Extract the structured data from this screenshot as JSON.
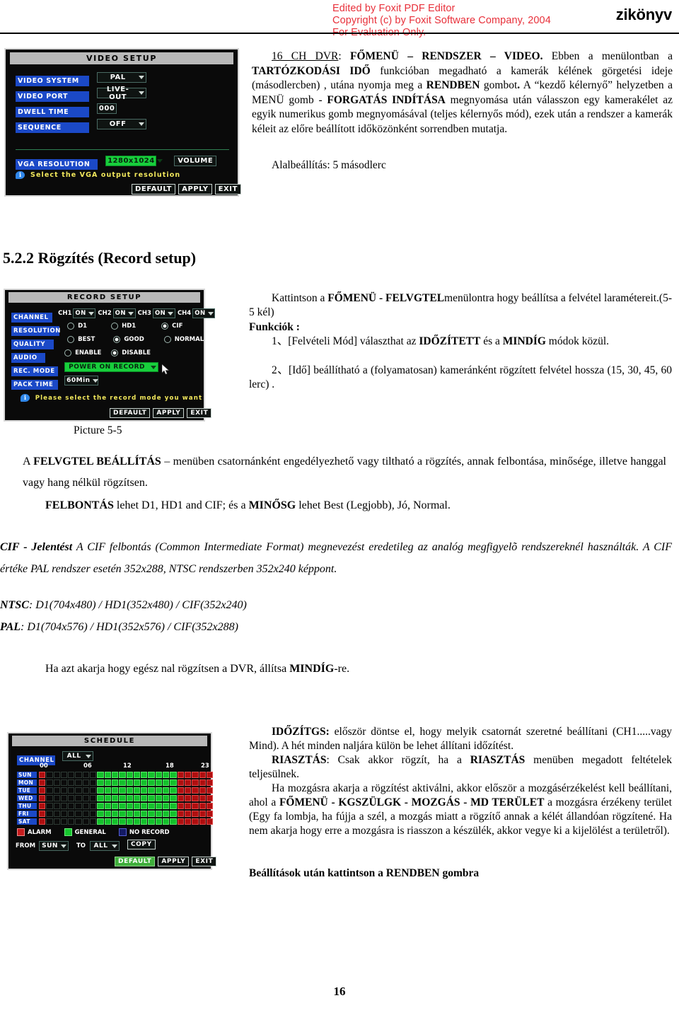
{
  "header": {
    "watermark_line1": "Edited by Foxit PDF Editor",
    "watermark_line2": "Copyright (c) by Foxit Software Company, 2004",
    "watermark_line3": "For Evaluation Only.",
    "doc_title_fragment": "zikönyv"
  },
  "video_setup": {
    "title": "VIDEO SETUP",
    "rows": [
      {
        "label": "VIDEO SYSTEM",
        "value": "PAL",
        "control": "dropdown"
      },
      {
        "label": "VIDEO PORT",
        "value": "LIVE-OUT",
        "control": "dropdown"
      },
      {
        "label": "DWELL TIME",
        "value": "000",
        "control": "textbox"
      },
      {
        "label": "SEQUENCE",
        "value": "OFF",
        "control": "dropdown"
      }
    ],
    "vga_label": "VGA RESOLUTION",
    "vga_value": "1280x1024",
    "volume_label": "VOLUME",
    "hint": "Select the VGA output resolution",
    "buttons": [
      "DEFAULT",
      "APPLY",
      "EXIT"
    ]
  },
  "video_text": {
    "lines": [
      {
        "t": "16 CH DVR",
        "s": "u"
      },
      {
        "t": ": ",
        "s": "n"
      },
      {
        "t": "FŐMENÜ – RENDSZER – VIDEO.",
        "s": "b"
      },
      {
        "t": " Ebben a menülontban a ",
        "s": "n"
      },
      {
        "t": "TARTÓZKODÁSI IDŐ",
        "s": "b"
      },
      {
        "t": " funkcióban megadható  a kamerák kélének görgetési ideje (másodlercben) , utána nyomja meg a ",
        "s": "n"
      },
      {
        "t": "RENDBEN",
        "s": "b"
      },
      {
        "t": " gombot",
        "s": "n"
      },
      {
        "t": ".",
        "s": "b"
      },
      {
        "t": "  A “kezdő kélernyő” helyzetben a MENÜ gomb - ",
        "s": "n"
      },
      {
        "t": "FORGATÁS INDÍTÁSA",
        "s": "b"
      },
      {
        "t": " megnyomása után válasszon egy kamerakélet az egyik numerikus gomb megnyomásával (teljes kélernyős mód), ezek után a rendszer a kamerák kéleit az előre beállított időközönként sorrendben mutatja.",
        "s": "n"
      }
    ],
    "default_line": "Alalbeállítás:  5 másodlerc"
  },
  "section_heading": "5.2.2 Rögzítés (Record setup)",
  "record_setup": {
    "title": "RECORD SETUP",
    "channel_label": "CHANNEL",
    "channels": [
      {
        "name": "CH1",
        "value": "ON"
      },
      {
        "name": "CH2",
        "value": "ON"
      },
      {
        "name": "CH3",
        "value": "ON"
      },
      {
        "name": "CH4",
        "value": "ON"
      }
    ],
    "resolution_label": "RESOLUTION",
    "resolution_options": [
      {
        "label": "D1",
        "selected": false
      },
      {
        "label": "HD1",
        "selected": false
      },
      {
        "label": "CIF",
        "selected": true
      }
    ],
    "quality_label": "QUALITY",
    "quality_options": [
      {
        "label": "BEST",
        "selected": false
      },
      {
        "label": "GOOD",
        "selected": true
      },
      {
        "label": "NORMAL",
        "selected": false
      }
    ],
    "audio_label": "AUDIO",
    "audio_options": [
      {
        "label": "ENABLE",
        "selected": false
      },
      {
        "label": "DISABLE",
        "selected": true
      }
    ],
    "rec_mode_label": "REC. MODE",
    "rec_mode_value": "POWER ON RECORD",
    "pack_time_label": "PACK TIME",
    "pack_time_value": "60Min",
    "hint": "Please select the record mode you want",
    "buttons": [
      "DEFAULT",
      "APPLY",
      "EXIT"
    ]
  },
  "record_caption": "Picture 5-5",
  "record_text": {
    "lines": [
      {
        "t": "Kattintson a ",
        "s": "n"
      },
      {
        "t": "FŐMENÜ - FELVGTEL",
        "s": "b"
      },
      {
        "t": "menülontra hogy beállítsa a felvétel laramétereit.(5-5 kél)",
        "s": "n"
      }
    ],
    "functions_label": "Funkciók :",
    "items": [
      {
        "prefix": "1、",
        "parts": [
          {
            "t": "[Felvételi Mód] választhat az ",
            "s": "n"
          },
          {
            "t": "IDŐZÍTETT",
            "s": "b"
          },
          {
            "t": "  és a ",
            "s": "n"
          },
          {
            "t": "MINDÍG",
            "s": "b"
          },
          {
            "t": " módok közül.",
            "s": "n"
          }
        ]
      },
      {
        "prefix": "2、",
        "parts": [
          {
            "t": "[Idő] beállítható a (folyamatosan) kameránként rögzített felvétel hossza (15, 30, 45, 60 lerc) .",
            "s": "n"
          }
        ]
      }
    ]
  },
  "para_felvgtel": [
    {
      "t": "A ",
      "s": "n"
    },
    {
      "t": "FELVGTEL BEÁLLÍTÁS ",
      "s": "b"
    },
    {
      "t": "– menüben csatornánként engedélyezhető vagy tiltható a rögzítés, annak felbontása, minősége, illetve hanggal vagy hang nélkül rögzítsen.",
      "s": "n"
    }
  ],
  "para_felbontas": [
    {
      "t": "FELBONTÁS",
      "s": "b"
    },
    {
      "t": "  lehet  D1, HD1 and CIF; és a  ",
      "s": "n"
    },
    {
      "t": "MINŐSG",
      "s": "b"
    },
    {
      "t": "   lehet Best (Legjobb), Jó, Normal.",
      "s": "n"
    }
  ],
  "para_cif": [
    {
      "t": "CIF - Jelentést",
      "s": "bi"
    },
    {
      "t": " A CIF felbontás (Common Intermediate Format) megnevezést eredetileg az analóg megfigyelõ rendszereknél használták. A CIF értéke PAL rendszer esetén 352x288, NTSC rendszerben 352x240 képpont.",
      "s": "i"
    }
  ],
  "line_ntsc": [
    {
      "t": "NTSC",
      "s": "bi"
    },
    {
      "t": ": D1(704x480) / HD1(352x480) / CIF(352x240)",
      "s": "i"
    }
  ],
  "line_pal": [
    {
      "t": "PAL",
      "s": "bi"
    },
    {
      "t": ": D1(704x576) / HD1(352x576) / CIF(352x288)",
      "s": "i"
    }
  ],
  "para_mindig": [
    {
      "t": "Ha azt akarja hogy egész nal rögzítsen a DVR, állítsa  ",
      "s": "n"
    },
    {
      "t": "MINDÍG",
      "s": "b"
    },
    {
      "t": "-re.",
      "s": "n"
    }
  ],
  "schedule": {
    "title": "SCHEDULE",
    "channel_label": "CHANNEL",
    "channel_value": "ALL",
    "hour_ticks": [
      "00",
      "06",
      "12",
      "18",
      "23"
    ],
    "days": [
      "SUN",
      "MON",
      "TUE",
      "WED",
      "THU",
      "FRI",
      "SAT"
    ],
    "legend": [
      {
        "label": "ALARM",
        "color": "#c61d1e"
      },
      {
        "label": "GENERAL",
        "color": "#16c72e"
      },
      {
        "label": "NO RECORD",
        "color": "#141a63"
      }
    ],
    "from_label": "FROM",
    "from_value": "SUN",
    "to_label": "TO",
    "to_value": "ALL",
    "copy_label": "COPY",
    "buttons": [
      "DEFAULT",
      "APPLY",
      "EXIT"
    ],
    "grid": [
      [
        "alarm",
        "none",
        "none",
        "none",
        "none",
        "none",
        "none",
        "none",
        "general",
        "general",
        "general",
        "general",
        "general",
        "general",
        "general",
        "general",
        "general",
        "general",
        "general",
        "alarm",
        "alarm",
        "alarm",
        "alarm",
        "alarm"
      ],
      [
        "alarm",
        "none",
        "none",
        "none",
        "none",
        "none",
        "none",
        "none",
        "general",
        "general",
        "general",
        "general",
        "general",
        "general",
        "general",
        "general",
        "general",
        "general",
        "general",
        "alarm",
        "alarm",
        "alarm",
        "alarm",
        "alarm"
      ],
      [
        "alarm",
        "none",
        "none",
        "none",
        "none",
        "none",
        "none",
        "none",
        "general",
        "general",
        "general",
        "general",
        "general",
        "general",
        "general",
        "general",
        "general",
        "general",
        "general",
        "alarm",
        "alarm",
        "alarm",
        "alarm",
        "alarm"
      ],
      [
        "alarm",
        "none",
        "none",
        "none",
        "none",
        "none",
        "none",
        "none",
        "general",
        "general",
        "general",
        "general",
        "general",
        "general",
        "general",
        "general",
        "general",
        "general",
        "general",
        "alarm",
        "alarm",
        "alarm",
        "alarm",
        "alarm"
      ],
      [
        "alarm",
        "none",
        "none",
        "none",
        "none",
        "none",
        "none",
        "none",
        "general",
        "general",
        "general",
        "general",
        "general",
        "general",
        "general",
        "general",
        "general",
        "general",
        "general",
        "alarm",
        "alarm",
        "alarm",
        "alarm",
        "alarm"
      ],
      [
        "alarm",
        "none",
        "none",
        "none",
        "none",
        "none",
        "none",
        "none",
        "general",
        "general",
        "general",
        "general",
        "general",
        "general",
        "general",
        "general",
        "general",
        "general",
        "general",
        "alarm",
        "alarm",
        "alarm",
        "alarm",
        "alarm"
      ],
      [
        "alarm",
        "none",
        "none",
        "none",
        "none",
        "none",
        "none",
        "none",
        "general",
        "general",
        "general",
        "general",
        "general",
        "general",
        "general",
        "general",
        "general",
        "general",
        "general",
        "alarm",
        "alarm",
        "alarm",
        "alarm",
        "alarm"
      ]
    ]
  },
  "schedule_text": {
    "p1": [
      {
        "t": "IDŐZÍTGS:",
        "s": "b"
      },
      {
        "t": " először döntse el, hogy melyik csatornát szeretné beállítani (CH1.....vagy Mind). A hét minden naljára külön be lehet állítani időzítést.",
        "s": "n"
      }
    ],
    "p2": [
      {
        "t": "RIASZTÁS",
        "s": "b"
      },
      {
        "t": ": Csak akkor rögzít, ha a ",
        "s": "n"
      },
      {
        "t": "RIASZTÁS",
        "s": "b"
      },
      {
        "t": " menüben megadott feltételek teljesülnek.",
        "s": "n"
      }
    ],
    "p3": [
      {
        "t": "Ha mozgásra akarja a rögzítést aktiválni, akkor először a mozgásérzékelést kell beállítani, ahol a ",
        "s": "n"
      },
      {
        "t": "FŐMENÜ - KGSZÜLGK - MOZGÁS - MD TERÜLET",
        "s": "b"
      },
      {
        "t": " a mozgásra érzékeny terület (Egy fa lombja, ha fújja a szél, a mozgás miatt a rögzítő annak a kélét állandóan rögzítené. Ha nem akarja hogy erre a mozgásra is riasszon a készülék, akkor vegye ki a kijelölést a területről).",
        "s": "n"
      }
    ],
    "p4": [
      {
        "t": "Beállítások után kattintson a RENDBEN gombra",
        "s": "b"
      }
    ]
  },
  "page_number": "16"
}
